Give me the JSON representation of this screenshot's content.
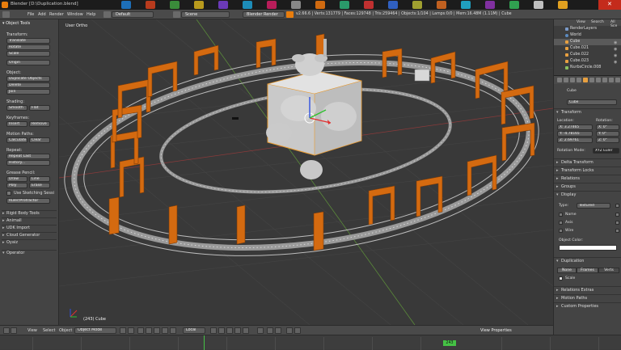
{
  "window": {
    "title": "Blender [D:\\Duplication.blend]",
    "close_label": "✕",
    "accent": "#e87d0d"
  },
  "info_header": {
    "menus": [
      "File",
      "Add",
      "Render",
      "Window",
      "Help"
    ],
    "screen_layout": "Default",
    "scene": "Scene",
    "render_engine": "Blender Render",
    "stats": "v2.66.6 | Verts:131779 | Faces:129748 | Tris:259464 | Objects:1/104 | Lamps:0/0 | Mem:16.48M (1.11M) | Cube"
  },
  "tool_shelf": {
    "header": "▾ Object Tools",
    "transform_label": "Transform:",
    "transform_buttons": [
      "Translate",
      "Rotate",
      "Scale"
    ],
    "origin_button": "Origin",
    "object_label": "Object:",
    "object_buttons": [
      "Duplicate Objects",
      "Delete",
      "Join"
    ],
    "shading_label": "Shading:",
    "shading_buttons": [
      "Smooth",
      "Flat"
    ],
    "keyframes_label": "Keyframes:",
    "keyframes_buttons": [
      "Insert",
      "Remove"
    ],
    "motion_label": "Motion Paths:",
    "motion_buttons": [
      "Calculate",
      "Clear"
    ],
    "repeat_label": "Repeat:",
    "repeat_buttons": [
      "Repeat Last",
      "History..."
    ],
    "grease_label": "Grease Pencil:",
    "grease_buttons": [
      "Draw",
      "Line",
      "Poly",
      "Erase"
    ],
    "sketching_label": "Use Sketching Sessi",
    "ruler_button": "Ruler/Protractor",
    "panels": [
      "Rigid Body Tools",
      "Animall",
      "UDK Import",
      "Cloud Generator",
      "Oyaiz",
      "Operator"
    ]
  },
  "viewport": {
    "view_label": "User Ortho",
    "object_label": "(243) Cube"
  },
  "outliner": {
    "header_items": [
      "View",
      "Search",
      "All Sce"
    ],
    "rows": [
      "RenderLayers",
      "World",
      "Cube",
      "Cube.021",
      "Cube.022",
      "Cube.023",
      "NurbsCircle.008"
    ]
  },
  "properties": {
    "object_name": "Cube",
    "object_field": "Cube",
    "transform_header": "Transform",
    "location_label": "Location:",
    "rotation_label": "Rotation:",
    "location": [
      "X: 3.27465",
      "Y: -4.78165",
      "Z: 2.69761"
    ],
    "rotation": [
      "X: 0°",
      "Y: 0°",
      "Z: 0°"
    ],
    "rotation_mode_label": "Rotation Mode:",
    "rotation_mode": "XYZ Euler",
    "collapsed_panels": [
      "Delta Transform",
      "Transform Locks",
      "Relations",
      "Groups"
    ],
    "display_header": "Display",
    "display_type_label": "Type:",
    "display_type": "Textured",
    "display_options": [
      "Name",
      "Axis",
      "Wire"
    ],
    "object_color_label": "Object Color:",
    "duplication_header": "Duplication",
    "duplication_tabs": [
      "None",
      "Frames",
      "Verts"
    ],
    "scale_label": "Scale",
    "more_panels": [
      "Relations Extras",
      "Motion Paths",
      "Custom Properties"
    ]
  },
  "view_header": {
    "menus": [
      "View",
      "Select",
      "Object"
    ],
    "mode": "Object Mode",
    "pivot": "Local",
    "view_properties": "View Properties"
  },
  "timeline": {
    "current_frame": "243"
  }
}
